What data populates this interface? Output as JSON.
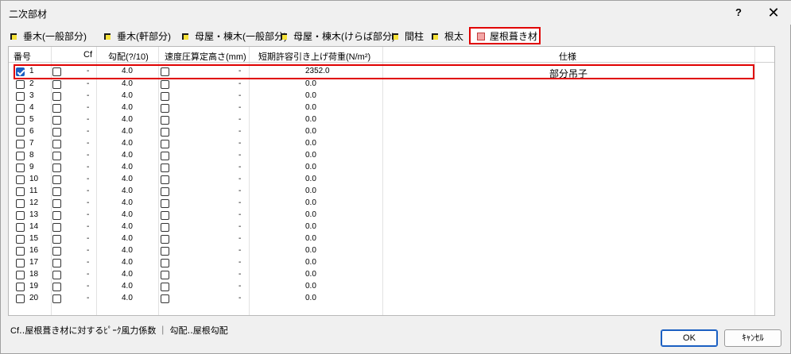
{
  "window": {
    "title": "二次部材",
    "help_label": "?",
    "close_label": "✕"
  },
  "tabs": [
    {
      "label": "垂木(一般部分)"
    },
    {
      "label": "垂木(軒部分)"
    },
    {
      "label": "母屋・棟木(一般部分)"
    },
    {
      "label": "母屋・棟木(けらば部分)"
    },
    {
      "label": "間柱"
    },
    {
      "label": "根太"
    },
    {
      "label": "屋根葺き材",
      "active": true
    }
  ],
  "grid": {
    "columns": [
      "番号",
      "Cf",
      "勾配(?/10)",
      "速度圧算定高さ(mm)",
      "短期許容引き上げ荷重(N/m²)",
      "仕様"
    ],
    "rows": [
      {
        "checked": true,
        "no": "1",
        "cf": "-",
        "slope": "4.0",
        "height": "-",
        "load": "2352.0",
        "spec": "部分吊子"
      },
      {
        "checked": false,
        "no": "2",
        "cf": "-",
        "slope": "4.0",
        "height": "-",
        "load": "0.0",
        "spec": ""
      },
      {
        "checked": false,
        "no": "3",
        "cf": "-",
        "slope": "4.0",
        "height": "-",
        "load": "0.0",
        "spec": ""
      },
      {
        "checked": false,
        "no": "4",
        "cf": "-",
        "slope": "4.0",
        "height": "-",
        "load": "0.0",
        "spec": ""
      },
      {
        "checked": false,
        "no": "5",
        "cf": "-",
        "slope": "4.0",
        "height": "-",
        "load": "0.0",
        "spec": ""
      },
      {
        "checked": false,
        "no": "6",
        "cf": "-",
        "slope": "4.0",
        "height": "-",
        "load": "0.0",
        "spec": ""
      },
      {
        "checked": false,
        "no": "7",
        "cf": "-",
        "slope": "4.0",
        "height": "-",
        "load": "0.0",
        "spec": ""
      },
      {
        "checked": false,
        "no": "8",
        "cf": "-",
        "slope": "4.0",
        "height": "-",
        "load": "0.0",
        "spec": ""
      },
      {
        "checked": false,
        "no": "9",
        "cf": "-",
        "slope": "4.0",
        "height": "-",
        "load": "0.0",
        "spec": ""
      },
      {
        "checked": false,
        "no": "10",
        "cf": "-",
        "slope": "4.0",
        "height": "-",
        "load": "0.0",
        "spec": ""
      },
      {
        "checked": false,
        "no": "11",
        "cf": "-",
        "slope": "4.0",
        "height": "-",
        "load": "0.0",
        "spec": ""
      },
      {
        "checked": false,
        "no": "12",
        "cf": "-",
        "slope": "4.0",
        "height": "-",
        "load": "0.0",
        "spec": ""
      },
      {
        "checked": false,
        "no": "13",
        "cf": "-",
        "slope": "4.0",
        "height": "-",
        "load": "0.0",
        "spec": ""
      },
      {
        "checked": false,
        "no": "14",
        "cf": "-",
        "slope": "4.0",
        "height": "-",
        "load": "0.0",
        "spec": ""
      },
      {
        "checked": false,
        "no": "15",
        "cf": "-",
        "slope": "4.0",
        "height": "-",
        "load": "0.0",
        "spec": ""
      },
      {
        "checked": false,
        "no": "16",
        "cf": "-",
        "slope": "4.0",
        "height": "-",
        "load": "0.0",
        "spec": ""
      },
      {
        "checked": false,
        "no": "17",
        "cf": "-",
        "slope": "4.0",
        "height": "-",
        "load": "0.0",
        "spec": ""
      },
      {
        "checked": false,
        "no": "18",
        "cf": "-",
        "slope": "4.0",
        "height": "-",
        "load": "0.0",
        "spec": ""
      },
      {
        "checked": false,
        "no": "19",
        "cf": "-",
        "slope": "4.0",
        "height": "-",
        "load": "0.0",
        "spec": ""
      },
      {
        "checked": false,
        "no": "20",
        "cf": "-",
        "slope": "4.0",
        "height": "-",
        "load": "0.0",
        "spec": ""
      }
    ]
  },
  "footer": {
    "note": "Cf‥屋根葺き材に対するﾋﾟｰｸ風力係数 ｜ 勾配‥屋根勾配",
    "ok_label": "OK",
    "cancel_label": "ｷｬﾝｾﾙ"
  },
  "colors": {
    "highlight": "#e00000",
    "accent": "#1a5fc2",
    "tab_flag": "#f5e23a"
  }
}
